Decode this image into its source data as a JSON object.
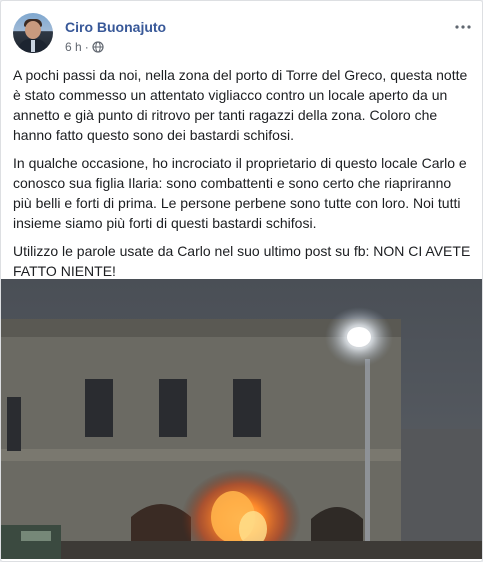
{
  "post": {
    "author": "Ciro Buonajuto",
    "time": "6 h",
    "separator": "·",
    "paragraphs": [
      "A pochi passi da noi, nella zona del porto di Torre del Greco, questa notte è stato commesso un attentato vigliacco contro un locale aperto da un annetto e già punto di ritrovo per tanti ragazzi della zona. Coloro che hanno fatto questo sono dei bastardi schifosi.",
      "In qualche occasione, ho incrociato il proprietario di questo locale Carlo e conosco sua figlia Ilaria: sono combattenti e sono certo che riapriranno più belli e forti di prima. Le persone perbene sono tutte con loro. Noi tutti insieme siamo più forti di questi bastardi schifosi.",
      "Utilizzo le parole usate da Carlo nel suo ultimo post su fb: NON CI AVETE FATTO NIENTE!"
    ],
    "audience_icon": "globe-icon",
    "menu_icon": "more-options-icon"
  },
  "colors": {
    "author_link": "#385898",
    "meta_text": "#616770",
    "body_text": "#1c1e21"
  }
}
